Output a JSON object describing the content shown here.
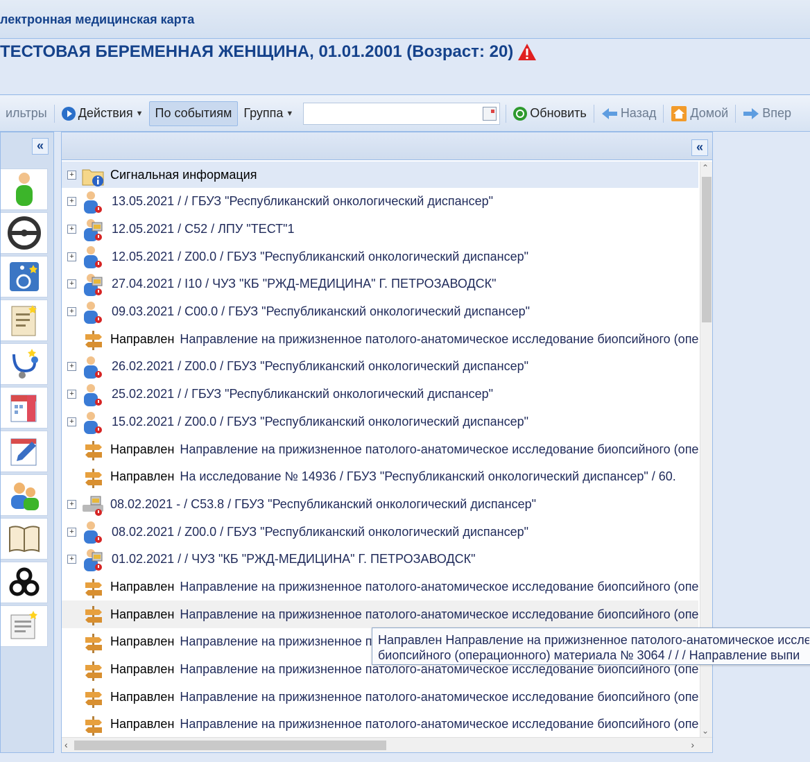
{
  "app": {
    "title": "лектронная медицинская карта"
  },
  "patient": {
    "name": "ТЕСТОВАЯ БЕРЕМЕННАЯ ЖЕНЩИНА, 01.01.2001 (Возраст: 20)"
  },
  "toolbar": {
    "filters": "ильтры",
    "actions": "Действия",
    "by_events": "По событиям",
    "group": "Группа",
    "search_value": "",
    "refresh": "Обновить",
    "back": "Назад",
    "home": "Домой",
    "forward": "Впер"
  },
  "colors": {
    "accent": "#15428b",
    "link": "#1f2a5a",
    "warning": "#e02020",
    "refresh": "#2e9a2e"
  },
  "sidebar": {
    "icons": [
      "person-icon",
      "steering-wheel-icon",
      "wheelchair-icon",
      "document-icon",
      "stethoscope-icon",
      "calendar-icon",
      "edit-icon",
      "users-icon",
      "book-icon",
      "biohazard-icon",
      "report-icon"
    ]
  },
  "tree": {
    "signal_info": "Сигнальная информация",
    "rows": [
      {
        "type": "visit",
        "text": "13.05.2021  /   /  ГБУЗ \"Республиканский онкологический диспансер\""
      },
      {
        "type": "visit-lock",
        "text": "12.05.2021  /  C52  /  ЛПУ \"ТЕСТ\"1"
      },
      {
        "type": "visit",
        "text": "12.05.2021  /  Z00.0  /  ГБУЗ \"Республиканский онкологический диспансер\""
      },
      {
        "type": "visit-lock",
        "text": "27.04.2021  /  I10  /  ЧУЗ \"КБ \"РЖД-МЕДИЦИНА\" Г. ПЕТРОЗАВОДСК\""
      },
      {
        "type": "visit",
        "text": "09.03.2021  /  C00.0  /  ГБУЗ \"Республиканский онкологический диспансер\""
      },
      {
        "type": "direction",
        "kw": "Направлен",
        "text": "Направление на прижизненное патолого-анатомическое исследование биопсийного (опер"
      },
      {
        "type": "visit",
        "text": "26.02.2021  /  Z00.0  /  ГБУЗ \"Республиканский онкологический диспансер\""
      },
      {
        "type": "visit",
        "text": "25.02.2021  /   /  ГБУЗ \"Республиканский онкологический диспансер\""
      },
      {
        "type": "visit",
        "text": "15.02.2021  /  Z00.0  /  ГБУЗ \"Республиканский онкологический диспансер\""
      },
      {
        "type": "direction",
        "kw": "Направлен",
        "text": "Направление на прижизненное патолого-анатомическое исследование биопсийного (опер"
      },
      {
        "type": "direction",
        "kw": "Направлен",
        "text": "На исследование  №  14936  /  ГБУЗ \"Республиканский онкологический диспансер\"  /  60."
      },
      {
        "type": "hosp",
        "text": "08.02.2021 - / C53.8 / ГБУЗ \"Республиканский онкологический диспансер\""
      },
      {
        "type": "visit",
        "text": "08.02.2021  /  Z00.0  /  ГБУЗ \"Республиканский онкологический диспансер\""
      },
      {
        "type": "visit-lock",
        "text": "01.02.2021  /   /  ЧУЗ \"КБ \"РЖД-МЕДИЦИНА\" Г. ПЕТРОЗАВОДСК\""
      },
      {
        "type": "direction",
        "kw": "Направлен",
        "text": "Направление на прижизненное патолого-анатомическое исследование биопсийного (опер"
      },
      {
        "type": "direction",
        "kw": "Направлен",
        "text": "Направление на прижизненное патолого-анатомическое исследование биопсийного (опер",
        "selected": true
      },
      {
        "type": "direction",
        "kw": "Направлен",
        "text": "Направление на прижизненное п"
      },
      {
        "type": "direction",
        "kw": "Направлен",
        "text": "Направление на прижизненное патолого-анатомическое исследование биопсийного (опер"
      },
      {
        "type": "direction",
        "kw": "Направлен",
        "text": "Направление на прижизненное патолого-анатомическое исследование биопсийного (опер"
      },
      {
        "type": "direction",
        "kw": "Направлен",
        "text": "Направление на прижизненное патолого-анатомическое исследование биопсийного (опер"
      }
    ]
  },
  "tooltip": {
    "line1": "Направлен Направление на прижизненное патолого-анатомическое иссле",
    "line2": "биопсийного (операционного) материала № 3064 / / / Направление выпи"
  }
}
